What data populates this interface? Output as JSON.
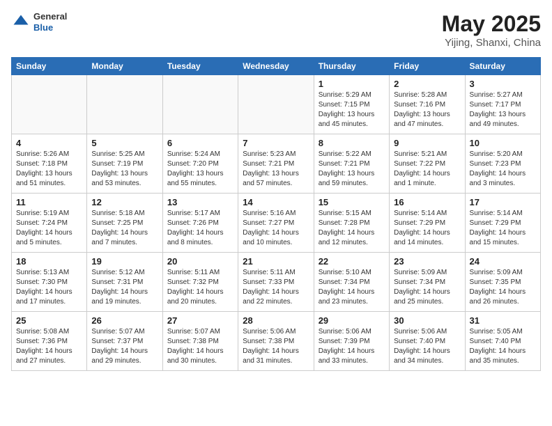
{
  "header": {
    "logo_general": "General",
    "logo_blue": "Blue",
    "main_title": "May 2025",
    "subtitle": "Yijing, Shanxi, China"
  },
  "days_of_week": [
    "Sunday",
    "Monday",
    "Tuesday",
    "Wednesday",
    "Thursday",
    "Friday",
    "Saturday"
  ],
  "weeks": [
    [
      {
        "day": "",
        "info": ""
      },
      {
        "day": "",
        "info": ""
      },
      {
        "day": "",
        "info": ""
      },
      {
        "day": "",
        "info": ""
      },
      {
        "day": "1",
        "info": "Sunrise: 5:29 AM\nSunset: 7:15 PM\nDaylight: 13 hours\nand 45 minutes."
      },
      {
        "day": "2",
        "info": "Sunrise: 5:28 AM\nSunset: 7:16 PM\nDaylight: 13 hours\nand 47 minutes."
      },
      {
        "day": "3",
        "info": "Sunrise: 5:27 AM\nSunset: 7:17 PM\nDaylight: 13 hours\nand 49 minutes."
      }
    ],
    [
      {
        "day": "4",
        "info": "Sunrise: 5:26 AM\nSunset: 7:18 PM\nDaylight: 13 hours\nand 51 minutes."
      },
      {
        "day": "5",
        "info": "Sunrise: 5:25 AM\nSunset: 7:19 PM\nDaylight: 13 hours\nand 53 minutes."
      },
      {
        "day": "6",
        "info": "Sunrise: 5:24 AM\nSunset: 7:20 PM\nDaylight: 13 hours\nand 55 minutes."
      },
      {
        "day": "7",
        "info": "Sunrise: 5:23 AM\nSunset: 7:21 PM\nDaylight: 13 hours\nand 57 minutes."
      },
      {
        "day": "8",
        "info": "Sunrise: 5:22 AM\nSunset: 7:21 PM\nDaylight: 13 hours\nand 59 minutes."
      },
      {
        "day": "9",
        "info": "Sunrise: 5:21 AM\nSunset: 7:22 PM\nDaylight: 14 hours\nand 1 minute."
      },
      {
        "day": "10",
        "info": "Sunrise: 5:20 AM\nSunset: 7:23 PM\nDaylight: 14 hours\nand 3 minutes."
      }
    ],
    [
      {
        "day": "11",
        "info": "Sunrise: 5:19 AM\nSunset: 7:24 PM\nDaylight: 14 hours\nand 5 minutes."
      },
      {
        "day": "12",
        "info": "Sunrise: 5:18 AM\nSunset: 7:25 PM\nDaylight: 14 hours\nand 7 minutes."
      },
      {
        "day": "13",
        "info": "Sunrise: 5:17 AM\nSunset: 7:26 PM\nDaylight: 14 hours\nand 8 minutes."
      },
      {
        "day": "14",
        "info": "Sunrise: 5:16 AM\nSunset: 7:27 PM\nDaylight: 14 hours\nand 10 minutes."
      },
      {
        "day": "15",
        "info": "Sunrise: 5:15 AM\nSunset: 7:28 PM\nDaylight: 14 hours\nand 12 minutes."
      },
      {
        "day": "16",
        "info": "Sunrise: 5:14 AM\nSunset: 7:29 PM\nDaylight: 14 hours\nand 14 minutes."
      },
      {
        "day": "17",
        "info": "Sunrise: 5:14 AM\nSunset: 7:29 PM\nDaylight: 14 hours\nand 15 minutes."
      }
    ],
    [
      {
        "day": "18",
        "info": "Sunrise: 5:13 AM\nSunset: 7:30 PM\nDaylight: 14 hours\nand 17 minutes."
      },
      {
        "day": "19",
        "info": "Sunrise: 5:12 AM\nSunset: 7:31 PM\nDaylight: 14 hours\nand 19 minutes."
      },
      {
        "day": "20",
        "info": "Sunrise: 5:11 AM\nSunset: 7:32 PM\nDaylight: 14 hours\nand 20 minutes."
      },
      {
        "day": "21",
        "info": "Sunrise: 5:11 AM\nSunset: 7:33 PM\nDaylight: 14 hours\nand 22 minutes."
      },
      {
        "day": "22",
        "info": "Sunrise: 5:10 AM\nSunset: 7:34 PM\nDaylight: 14 hours\nand 23 minutes."
      },
      {
        "day": "23",
        "info": "Sunrise: 5:09 AM\nSunset: 7:34 PM\nDaylight: 14 hours\nand 25 minutes."
      },
      {
        "day": "24",
        "info": "Sunrise: 5:09 AM\nSunset: 7:35 PM\nDaylight: 14 hours\nand 26 minutes."
      }
    ],
    [
      {
        "day": "25",
        "info": "Sunrise: 5:08 AM\nSunset: 7:36 PM\nDaylight: 14 hours\nand 27 minutes."
      },
      {
        "day": "26",
        "info": "Sunrise: 5:07 AM\nSunset: 7:37 PM\nDaylight: 14 hours\nand 29 minutes."
      },
      {
        "day": "27",
        "info": "Sunrise: 5:07 AM\nSunset: 7:38 PM\nDaylight: 14 hours\nand 30 minutes."
      },
      {
        "day": "28",
        "info": "Sunrise: 5:06 AM\nSunset: 7:38 PM\nDaylight: 14 hours\nand 31 minutes."
      },
      {
        "day": "29",
        "info": "Sunrise: 5:06 AM\nSunset: 7:39 PM\nDaylight: 14 hours\nand 33 minutes."
      },
      {
        "day": "30",
        "info": "Sunrise: 5:06 AM\nSunset: 7:40 PM\nDaylight: 14 hours\nand 34 minutes."
      },
      {
        "day": "31",
        "info": "Sunrise: 5:05 AM\nSunset: 7:40 PM\nDaylight: 14 hours\nand 35 minutes."
      }
    ]
  ]
}
